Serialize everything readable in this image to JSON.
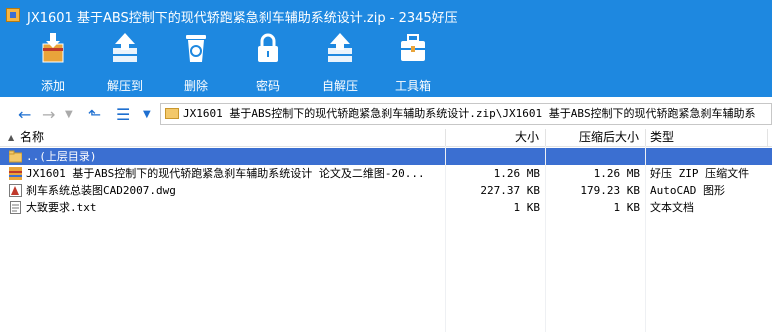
{
  "window": {
    "title": "JX1601 基于ABS控制下的现代轿跑紧急刹车辅助系统设计.zip - 2345好压"
  },
  "toolbar": [
    {
      "label": "添加",
      "icon": "add-archive-icon"
    },
    {
      "label": "解压到",
      "icon": "extract-to-icon"
    },
    {
      "label": "删除",
      "icon": "recycle-bin-icon"
    },
    {
      "label": "密码",
      "icon": "lock-icon"
    },
    {
      "label": "自解压",
      "icon": "self-extract-icon"
    },
    {
      "label": "工具箱",
      "icon": "toolbox-icon"
    }
  ],
  "address": {
    "path": "JX1601 基于ABS控制下的现代轿跑紧急刹车辅助系统设计.zip\\JX1601 基于ABS控制下的现代轿跑紧急刹车辅助系"
  },
  "columns": {
    "name": "名称",
    "size": "大小",
    "packed": "压缩后大小",
    "type": "类型"
  },
  "parent_row": {
    "name": "..(上层目录)"
  },
  "files": [
    {
      "name": "JX1601 基于ABS控制下的现代轿跑紧急刹车辅助系统设计 论文及二维图-20...",
      "size": "1.26 MB",
      "packed": "1.26 MB",
      "type": "好压 ZIP 压缩文件",
      "icon": "zip-archive-icon"
    },
    {
      "name": "刹车系统总装图CAD2007.dwg",
      "size": "227.37 KB",
      "packed": "179.23 KB",
      "type": "AutoCAD 图形",
      "icon": "autocad-file-icon"
    },
    {
      "name": "大致要求.txt",
      "size": "1 KB",
      "packed": "1 KB",
      "type": "文本文档",
      "icon": "text-file-icon"
    }
  ],
  "colors": {
    "accent": "#1e88e0",
    "selection": "#3b6fd1"
  }
}
